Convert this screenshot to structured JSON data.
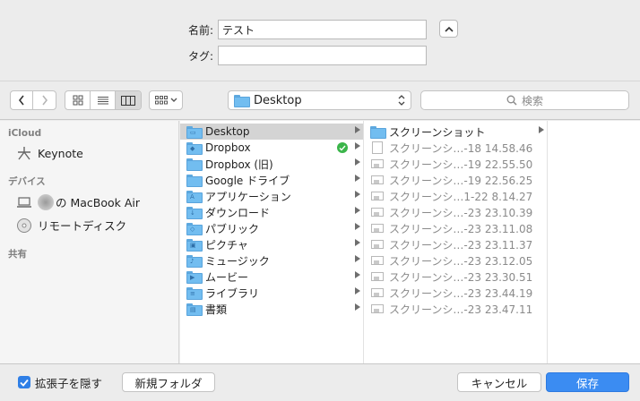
{
  "form": {
    "name_label": "名前:",
    "name_value": "テスト",
    "tag_label": "タグ:",
    "tag_value": ""
  },
  "toolbar": {
    "location": "Desktop",
    "search_placeholder": "検索"
  },
  "sidebar": {
    "icloud_heading": "iCloud",
    "icloud_items": [
      {
        "label": "Keynote",
        "icon": "keynote-icon"
      }
    ],
    "devices_heading": "デバイス",
    "device_items": [
      {
        "label": "の MacBook Air",
        "icon": "laptop-icon"
      },
      {
        "label": "リモートディスク",
        "icon": "disc-icon"
      }
    ],
    "shared_heading": "共有"
  },
  "column1": [
    {
      "label": "Desktop",
      "icon": "desktop-folder-icon",
      "selected": true
    },
    {
      "label": "Dropbox",
      "icon": "dropbox-folder-icon",
      "status": "synced"
    },
    {
      "label": "Dropbox (旧)",
      "icon": "folder-icon"
    },
    {
      "label": "Google ドライブ",
      "icon": "folder-icon"
    },
    {
      "label": "アプリケーション",
      "icon": "applications-folder-icon"
    },
    {
      "label": "ダウンロード",
      "icon": "downloads-folder-icon"
    },
    {
      "label": "パブリック",
      "icon": "public-folder-icon"
    },
    {
      "label": "ピクチャ",
      "icon": "pictures-folder-icon"
    },
    {
      "label": "ミュージック",
      "icon": "music-folder-icon"
    },
    {
      "label": "ムービー",
      "icon": "movies-folder-icon"
    },
    {
      "label": "ライブラリ",
      "icon": "library-folder-icon"
    },
    {
      "label": "書類",
      "icon": "documents-folder-icon"
    }
  ],
  "column2": [
    {
      "label": "スクリーンショット",
      "icon": "folder-icon"
    },
    {
      "label": "スクリーンシ…-18 14.58.46",
      "icon": "file-icon"
    },
    {
      "label": "スクリーンシ…-19 22.55.50",
      "icon": "image-file-icon"
    },
    {
      "label": "スクリーンシ…-19 22.56.25",
      "icon": "image-file-icon"
    },
    {
      "label": "スクリーンシ…1-22 8.14.27",
      "icon": "image-file-icon"
    },
    {
      "label": "スクリーンシ…-23 23.10.39",
      "icon": "image-file-icon"
    },
    {
      "label": "スクリーンシ…-23 23.11.08",
      "icon": "image-file-icon"
    },
    {
      "label": "スクリーンシ…-23 23.11.37",
      "icon": "image-file-icon"
    },
    {
      "label": "スクリーンシ…-23 23.12.05",
      "icon": "image-file-icon"
    },
    {
      "label": "スクリーンシ…-23 23.30.51",
      "icon": "image-file-icon"
    },
    {
      "label": "スクリーンシ…-23 23.44.19",
      "icon": "image-file-icon"
    },
    {
      "label": "スクリーンシ…-23 23.47.11",
      "icon": "image-file-icon"
    }
  ],
  "bottom": {
    "hide_extension_label": "拡張子を隠す",
    "hide_extension_checked": true,
    "new_folder_label": "新規フォルダ",
    "cancel_label": "キャンセル",
    "save_label": "保存"
  },
  "colors": {
    "accent": "#3b8cf2",
    "folder": "#72bdf0",
    "selection": "#d4d4d4",
    "sync_badge": "#3bb54a"
  }
}
